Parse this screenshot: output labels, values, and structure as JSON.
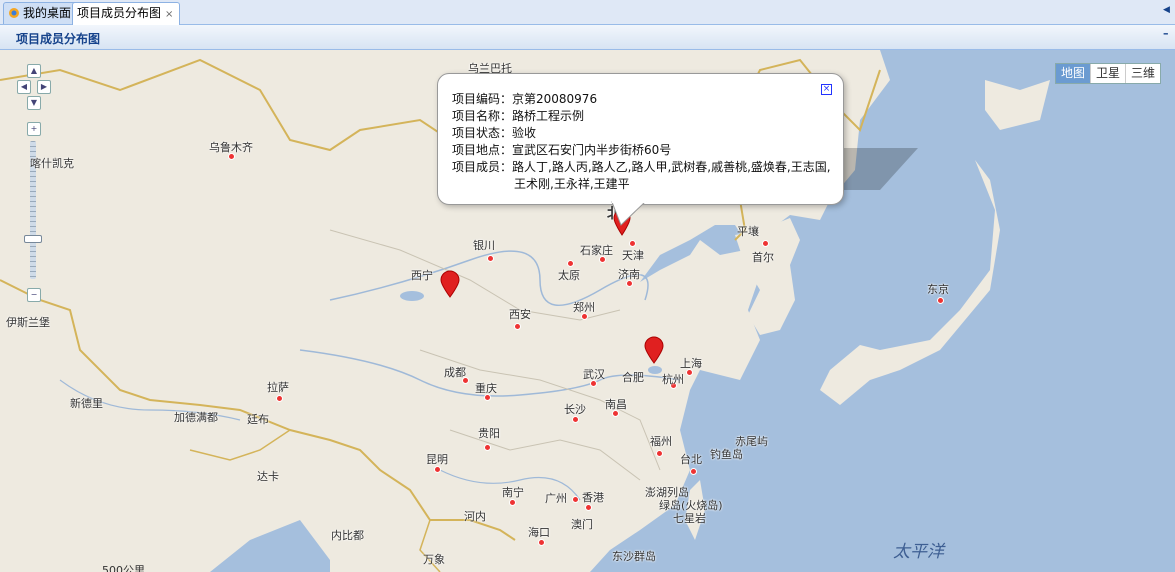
{
  "tabs": [
    {
      "label": "我的桌面",
      "icon": "home-icon"
    },
    {
      "label": "项目成员分布图",
      "icon": "",
      "close": "×"
    }
  ],
  "panel": {
    "title": "项目成员分布图"
  },
  "map_types": [
    "地图",
    "卫星",
    "三维"
  ],
  "popup": {
    "rows": [
      {
        "key": "项目编码：",
        "value": "京第20080976"
      },
      {
        "key": "项目名称：",
        "value": "路桥工程示例"
      },
      {
        "key": "项目状态：",
        "value": "验收"
      },
      {
        "key": "项目地点：",
        "value": "宣武区石安门内半步街桥60号"
      },
      {
        "key": "项目成员：",
        "value": "路人丁,路人丙,路人乙,路人甲,武树春,戚善桃,盛焕春,王志国,",
        "value2": "王术刚,王永祥,王建平"
      }
    ]
  },
  "cities": {
    "wulanbatuo": "乌兰巴托",
    "wulumuqi": "乌鲁木齐",
    "kashi": "喀什凯克",
    "yinchuan": "银川",
    "shijiazhuang": "石家庄",
    "tianjin": "天津",
    "pingrang": "平壤",
    "shouer": "首尔",
    "taiyuan": "太原",
    "jinan": "济南",
    "xining": "西宁",
    "zhengzhou": "郑州",
    "xian": "西安",
    "yisilanbao": "伊斯兰堡",
    "dongjing": "东京",
    "chengdu": "成都",
    "chongqing": "重庆",
    "wuhan": "武汉",
    "hefei": "合肥",
    "shanghai": "上海",
    "hangzhou": "杭州",
    "lasa": "拉萨",
    "xindeli": "新德里",
    "jiademandu": "加德满都",
    "tingbu": "廷布",
    "changsha": "长沙",
    "nanchang": "南昌",
    "guiyang": "贵阳",
    "fuzhou": "福州",
    "taibei": "台北",
    "chiweiyu": "赤尾屿",
    "diaoyudao": "钓鱼岛",
    "dhaka": "达卡",
    "kunming": "昆明",
    "penghu": "澎湖列岛",
    "lvdao": "绿岛(火烧岛)",
    "qixingyan": "七星岩",
    "nanning": "南宁",
    "guangzhou": "广州",
    "xianggang": "香港",
    "aomen": "澳门",
    "hanoi": "河内",
    "haikou": "海口",
    "nabidu": "内比都",
    "wanxiang": "万象",
    "dongsha": "东沙群岛",
    "beijing_partial": "北"
  },
  "ocean": "太平洋",
  "scale": "500公里",
  "colors": {
    "land": "#eeeae0",
    "water": "#a5bfdd",
    "pin": "#e02020",
    "border": "#d4b45a"
  }
}
